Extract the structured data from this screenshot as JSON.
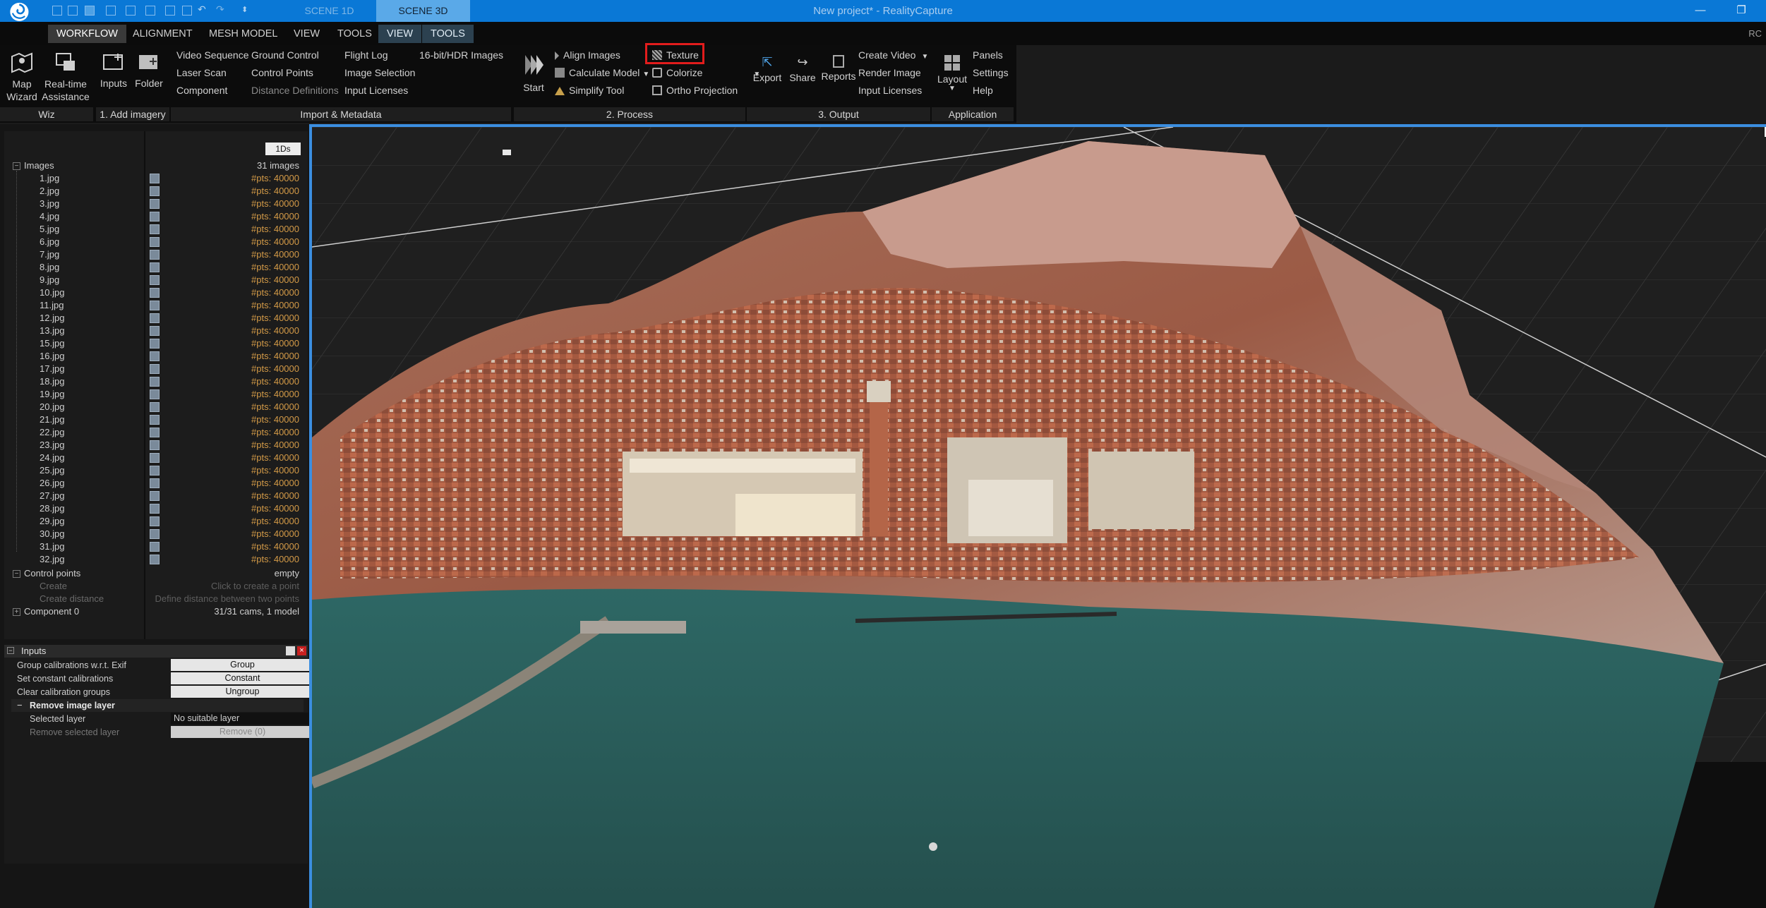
{
  "title_bar": {
    "app_title": "New project* - RealityCapture",
    "scene_tabs": [
      "SCENE 1D",
      "SCENE 3D"
    ],
    "active_scene": "SCENE 3D"
  },
  "menu": {
    "items": [
      "WORKFLOW",
      "ALIGNMENT",
      "MESH MODEL",
      "VIEW",
      "TOOLS",
      "VIEW",
      "TOOLS"
    ],
    "user_badge": "RC"
  },
  "ribbon": {
    "wiz": {
      "map_wizard": "Map\nWizard",
      "realtime_assistance": "Real-time\nAssistance",
      "label": "Wiz"
    },
    "add_imagery": {
      "inputs": "Inputs",
      "folder": "Folder",
      "label": "1. Add imagery"
    },
    "import_metadata": {
      "col1": [
        "Video Sequence",
        "Laser Scan",
        "Component"
      ],
      "col2": [
        "Ground Control",
        "Control Points",
        "Distance Definitions"
      ],
      "col3": [
        "Flight Log",
        "Image Selection",
        "Input Licenses"
      ],
      "col4": [
        "16-bit/HDR Images"
      ],
      "label": "Import & Metadata"
    },
    "process": {
      "start": "Start",
      "col1": [
        "Align Images",
        "Calculate Model",
        "Simplify Tool"
      ],
      "col2": [
        "Texture",
        "Colorize",
        "Ortho Projection"
      ],
      "label": "2. Process"
    },
    "output": {
      "export": "Export",
      "share": "Share",
      "reports": "Reports",
      "col": [
        "Create Video",
        "Render Image",
        "Input Licenses"
      ],
      "label": "3. Output"
    },
    "application": {
      "layout": "Layout",
      "col": [
        "Panels",
        "Settings",
        "Help"
      ],
      "label": "Application"
    }
  },
  "tree": {
    "mode_button": "1Ds",
    "images_label": "Images",
    "images_count": "31 images",
    "images": [
      {
        "name": "1.jpg",
        "pts": "#pts: 40000"
      },
      {
        "name": "2.jpg",
        "pts": "#pts: 40000"
      },
      {
        "name": "3.jpg",
        "pts": "#pts: 40000"
      },
      {
        "name": "4.jpg",
        "pts": "#pts: 40000"
      },
      {
        "name": "5.jpg",
        "pts": "#pts: 40000"
      },
      {
        "name": "6.jpg",
        "pts": "#pts: 40000"
      },
      {
        "name": "7.jpg",
        "pts": "#pts: 40000"
      },
      {
        "name": "8.jpg",
        "pts": "#pts: 40000"
      },
      {
        "name": "9.jpg",
        "pts": "#pts: 40000"
      },
      {
        "name": "10.jpg",
        "pts": "#pts: 40000"
      },
      {
        "name": "11.jpg",
        "pts": "#pts: 40000"
      },
      {
        "name": "12.jpg",
        "pts": "#pts: 40000"
      },
      {
        "name": "13.jpg",
        "pts": "#pts: 40000"
      },
      {
        "name": "15.jpg",
        "pts": "#pts: 40000"
      },
      {
        "name": "16.jpg",
        "pts": "#pts: 40000"
      },
      {
        "name": "17.jpg",
        "pts": "#pts: 40000"
      },
      {
        "name": "18.jpg",
        "pts": "#pts: 40000"
      },
      {
        "name": "19.jpg",
        "pts": "#pts: 40000"
      },
      {
        "name": "20.jpg",
        "pts": "#pts: 40000"
      },
      {
        "name": "21.jpg",
        "pts": "#pts: 40000"
      },
      {
        "name": "22.jpg",
        "pts": "#pts: 40000"
      },
      {
        "name": "23.jpg",
        "pts": "#pts: 40000"
      },
      {
        "name": "24.jpg",
        "pts": "#pts: 40000"
      },
      {
        "name": "25.jpg",
        "pts": "#pts: 40000"
      },
      {
        "name": "26.jpg",
        "pts": "#pts: 40000"
      },
      {
        "name": "27.jpg",
        "pts": "#pts: 40000"
      },
      {
        "name": "28.jpg",
        "pts": "#pts: 40000"
      },
      {
        "name": "29.jpg",
        "pts": "#pts: 40000"
      },
      {
        "name": "30.jpg",
        "pts": "#pts: 40000"
      },
      {
        "name": "31.jpg",
        "pts": "#pts: 40000"
      },
      {
        "name": "32.jpg",
        "pts": "#pts: 40000"
      }
    ],
    "control_points_label": "Control points",
    "control_points_value": "empty",
    "create_label": "Create",
    "create_hint": "Click to create a point",
    "create_distance_label": "Create distance",
    "create_distance_hint": "Define distance between two points",
    "component_label": "Component 0",
    "component_value": "31/31 cams, 1 model"
  },
  "inputs_panel": {
    "title": "Inputs",
    "rows": [
      {
        "label": "Group calibrations w.r.t. Exif",
        "button": "Group"
      },
      {
        "label": "Set constant calibrations",
        "button": "Constant"
      },
      {
        "label": "Clear calibration groups",
        "button": "Ungroup"
      }
    ],
    "section_title": "Remove image layer",
    "selected_layer_label": "Selected layer",
    "selected_layer_value": "No suitable layer",
    "remove_label": "Remove selected layer",
    "remove_button": "Remove (0)"
  },
  "colors": {
    "titlebar": "#0a78d6",
    "viewport_border": "#3b8ee0",
    "highlight": "#e21c1c",
    "pts_text": "#d39a47"
  }
}
